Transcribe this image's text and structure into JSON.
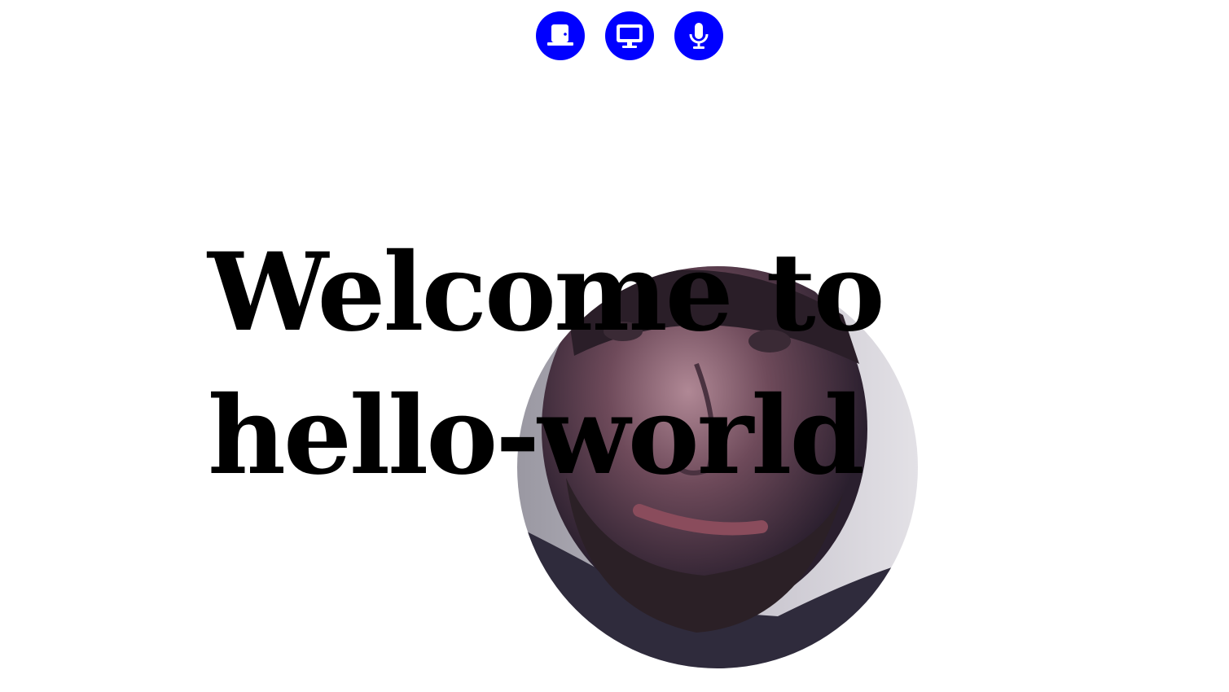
{
  "toolbar": {
    "buttons": [
      {
        "name": "leave-button",
        "icon": "door-icon"
      },
      {
        "name": "screen-share-button",
        "icon": "monitor-icon"
      },
      {
        "name": "microphone-button",
        "icon": "microphone-icon"
      }
    ]
  },
  "colors": {
    "accent": "#0000ff",
    "icon": "#ffffff",
    "text": "#000000",
    "background": "#ffffff"
  },
  "heading": {
    "line1": "Welcome to",
    "line2": "hello-world"
  },
  "video": {
    "shape": "circle"
  }
}
